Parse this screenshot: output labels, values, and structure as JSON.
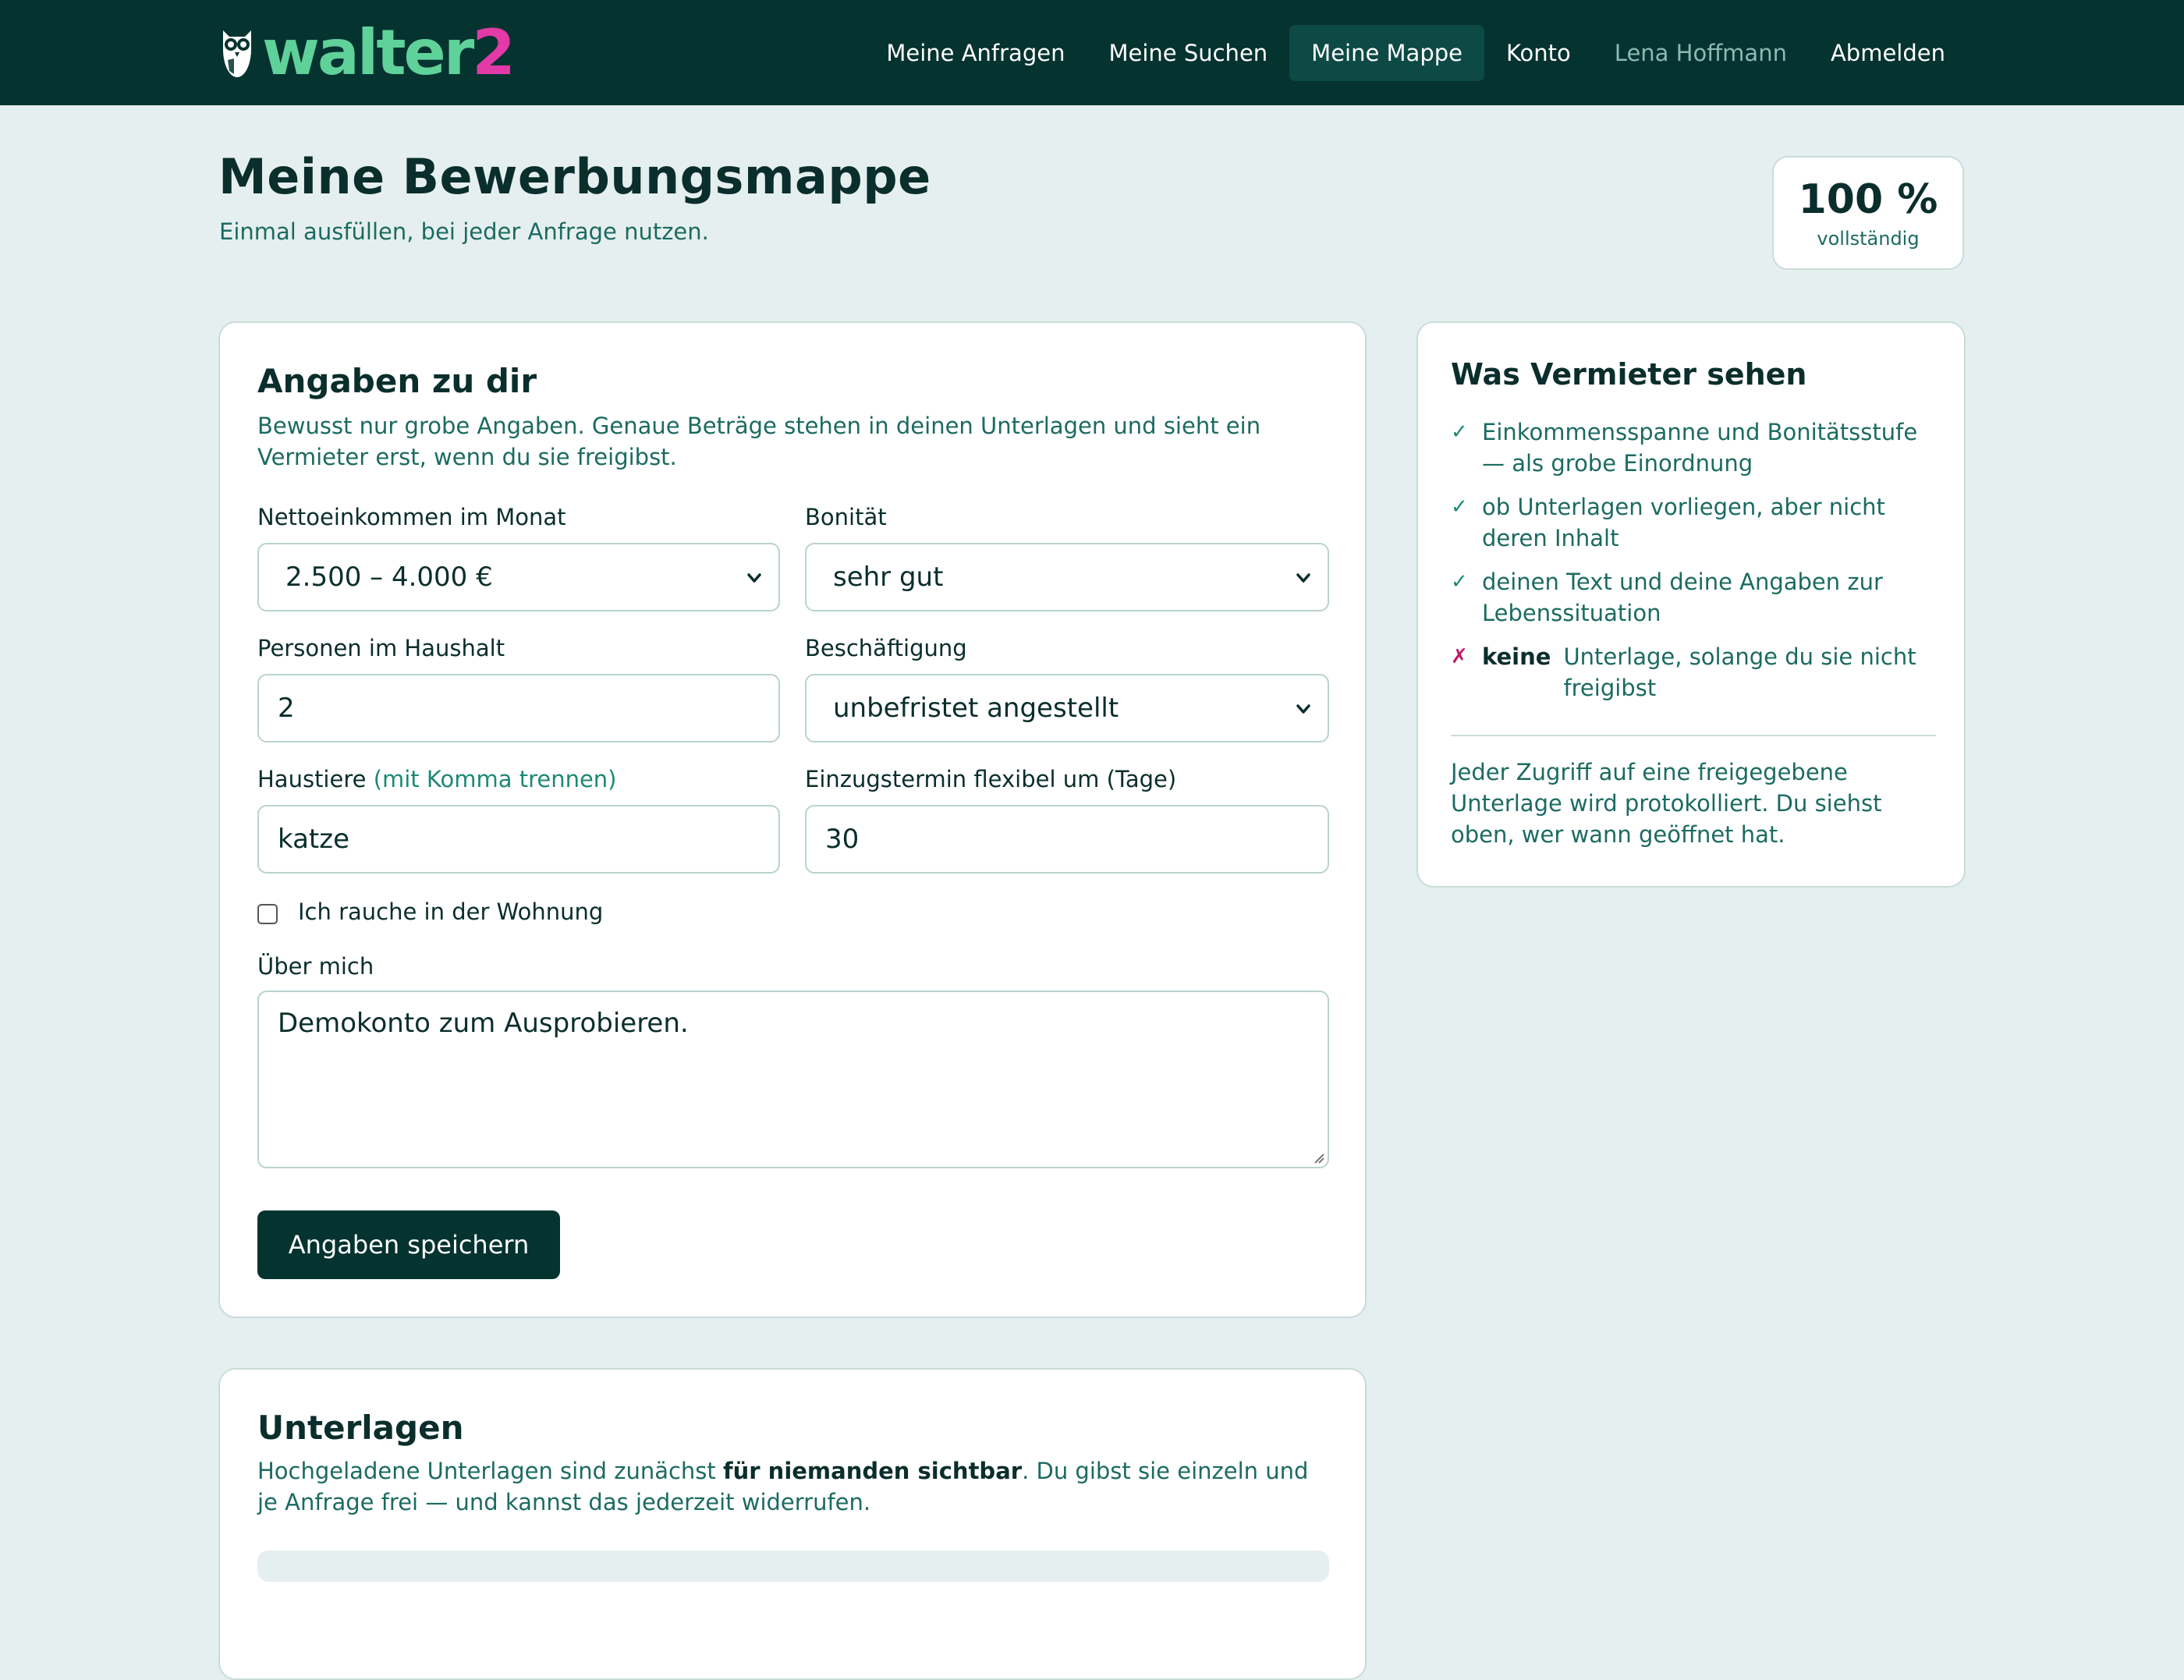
{
  "app": {
    "logo_main": "walter",
    "logo_accent": "2"
  },
  "nav": {
    "items": [
      {
        "label": "Meine Anfragen"
      },
      {
        "label": "Meine Suchen"
      },
      {
        "label": "Meine Mappe"
      },
      {
        "label": "Konto"
      },
      {
        "label": "Lena Hoffmann"
      },
      {
        "label": "Abmelden"
      }
    ],
    "active": "Meine Mappe"
  },
  "page": {
    "title": "Meine Bewerbungsmappe",
    "subtitle": "Einmal ausfüllen, bei jeder Anfrage nutzen."
  },
  "completeness": {
    "value": "100 %",
    "label": "vollständig",
    "fraction": 1.0
  },
  "profile": {
    "heading": "Angaben zu dir",
    "intro": "Bewusst nur grobe Angaben. Genaue Beträge stehen in deinen Unterlagen und sieht ein Vermieter erst, wenn du sie freigibst.",
    "income_label": "Nettoeinkommen im Monat",
    "income_value": "2.500 – 4.000 €",
    "credit_label": "Bonität",
    "credit_value": "sehr gut",
    "household_label": "Personen im Haushalt",
    "household_value": "2",
    "employment_label": "Beschäftigung",
    "employment_value": "unbefristet angestellt",
    "pets_label": "Haustiere",
    "pets_hint": "(mit Komma trennen)",
    "pets_value": "katze",
    "movein_label": "Einzugstermin flexibel um (Tage)",
    "movein_value": "30",
    "smoker_label": "Ich rauche in der Wohnung",
    "smoker_checked": false,
    "about_label": "Über mich",
    "about_value": "Demokonto zum Ausprobieren.",
    "save_label": "Angaben speichern"
  },
  "side": {
    "heading": "Was Vermieter sehen",
    "items": [
      {
        "mark": "✓",
        "text": "Einkommensspanne und Bonitätsstufe — als grobe Einordnung"
      },
      {
        "mark": "✓",
        "text": "ob Unterlagen vorliegen, aber nicht deren Inhalt"
      },
      {
        "mark": "✓",
        "text": "deinen Text und deine Angaben zur Lebenssituation"
      },
      {
        "mark": "✗",
        "strong": "keine",
        "text": "Unterlage, solange du sie nicht freigibst"
      }
    ],
    "note": "Jeder Zugriff auf eine freigegebene Unterlage wird protokolliert. Du siehst oben, wer wann geöffnet hat."
  },
  "docs": {
    "heading": "Unterlagen",
    "intro_before": "Hochgeladene Unterlagen sind zunächst ",
    "intro_bold": "für niemanden sichtbar",
    "intro_after": ". Du gibst sie einzeln und je Anfrage frei — und kannst das jederzeit widerrufen."
  },
  "colors": {
    "brand_dark": "#053330",
    "brand_green": "#5fd29a",
    "brand_pink": "#e23aa6",
    "text_muted": "#1b6b61"
  }
}
